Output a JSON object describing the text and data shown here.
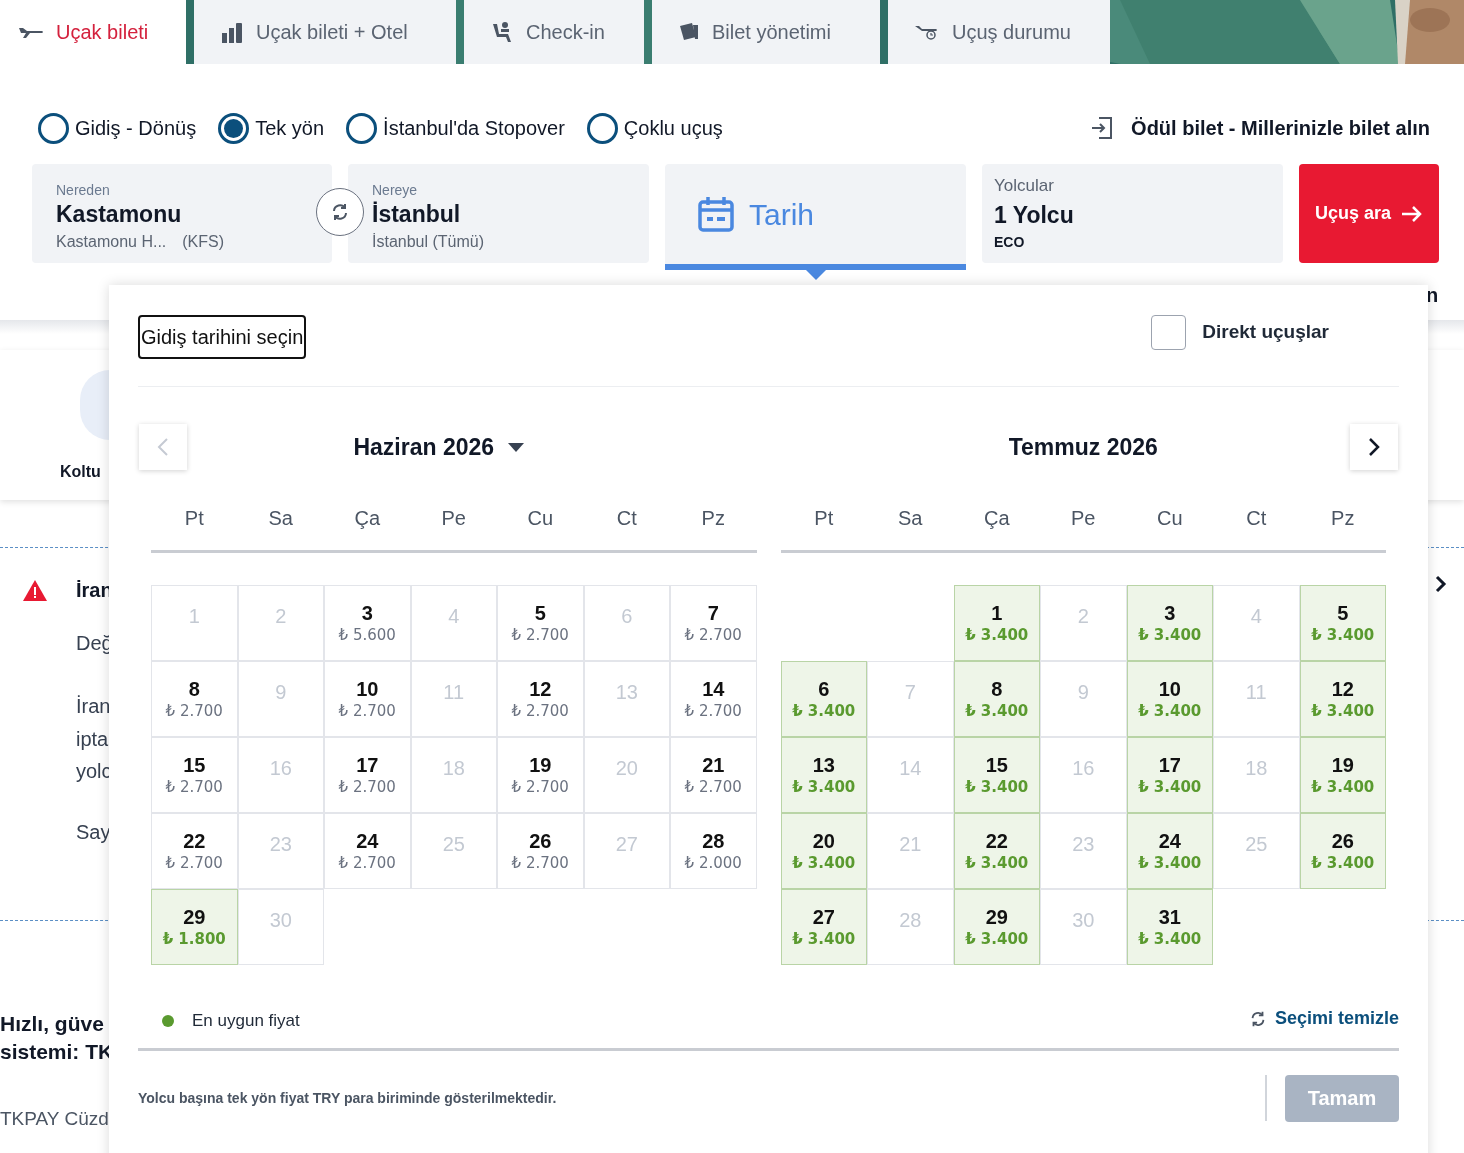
{
  "tabs": [
    {
      "label": "Uçak bileti",
      "kind": "plane",
      "selected": true
    },
    {
      "label": "Uçak bileti + Otel",
      "kind": "hotel",
      "selected": false
    },
    {
      "label": "Check-in",
      "kind": "seat",
      "selected": false
    },
    {
      "label": "Bilet yönetimi",
      "kind": "ticket",
      "selected": false
    },
    {
      "label": "Uçuş durumu",
      "kind": "status",
      "selected": false
    }
  ],
  "trip_types": [
    {
      "label": "Gidiş - Dönüş",
      "selected": false
    },
    {
      "label": "Tek yön",
      "selected": true
    },
    {
      "label": "İstanbul'da Stopover",
      "selected": false
    },
    {
      "label": "Çoklu uçuş",
      "selected": false
    }
  ],
  "award_link": "Ödül bilet - Millerinizle bilet alın",
  "origin": {
    "label": "Nereden",
    "city": "Kastamonu",
    "airport": "Kastamonu H...",
    "code": "(KFS)"
  },
  "destination": {
    "label": "Nereye",
    "city": "İstanbul",
    "airport": "İstanbul (Tümü)"
  },
  "date_field": {
    "label": "Tarih",
    "selected": true
  },
  "passengers": {
    "label": "Yolcular",
    "value": "1 Yolcu",
    "cabin": "ECO"
  },
  "search_button": "Uçuş ara",
  "background_page": {
    "service_label": "Koltu",
    "right_fragment": "n",
    "notice": {
      "title": "İran",
      "lines": [
        "Değ",
        "İran",
        "ipta",
        "yolc",
        "Say"
      ]
    },
    "promo_title": [
      "Hızlı, güve",
      "sistemi: TK"
    ],
    "promo_text": "TKPAY Cüzd"
  },
  "calendar": {
    "heading": "Gidiş tarihini seçin",
    "direct_flights": {
      "label": "Direkt uçuşlar",
      "checked": false
    },
    "months": [
      {
        "title": "Haziran 2026",
        "dropdown": true,
        "weekdays": [
          "Pt",
          "Sa",
          "Ça",
          "Pe",
          "Cu",
          "Ct",
          "Pz"
        ],
        "days": [
          {
            "kind": "unavailable",
            "day": "1"
          },
          {
            "kind": "unavailable",
            "day": "2"
          },
          {
            "kind": "available",
            "day": "3",
            "price": "₺ 5.600"
          },
          {
            "kind": "unavailable",
            "day": "4"
          },
          {
            "kind": "available",
            "day": "5",
            "price": "₺ 2.700"
          },
          {
            "kind": "unavailable",
            "day": "6"
          },
          {
            "kind": "available",
            "day": "7",
            "price": "₺ 2.700"
          },
          {
            "kind": "available",
            "day": "8",
            "price": "₺ 2.700"
          },
          {
            "kind": "unavailable",
            "day": "9"
          },
          {
            "kind": "available",
            "day": "10",
            "price": "₺ 2.700"
          },
          {
            "kind": "unavailable",
            "day": "11"
          },
          {
            "kind": "available",
            "day": "12",
            "price": "₺ 2.700"
          },
          {
            "kind": "unavailable",
            "day": "13"
          },
          {
            "kind": "available",
            "day": "14",
            "price": "₺ 2.700"
          },
          {
            "kind": "available",
            "day": "15",
            "price": "₺ 2.700"
          },
          {
            "kind": "unavailable",
            "day": "16"
          },
          {
            "kind": "available",
            "day": "17",
            "price": "₺ 2.700"
          },
          {
            "kind": "unavailable",
            "day": "18"
          },
          {
            "kind": "available",
            "day": "19",
            "price": "₺ 2.700"
          },
          {
            "kind": "unavailable",
            "day": "20"
          },
          {
            "kind": "available",
            "day": "21",
            "price": "₺ 2.700"
          },
          {
            "kind": "available",
            "day": "22",
            "price": "₺ 2.700"
          },
          {
            "kind": "unavailable",
            "day": "23"
          },
          {
            "kind": "available",
            "day": "24",
            "price": "₺ 2.700"
          },
          {
            "kind": "unavailable",
            "day": "25"
          },
          {
            "kind": "available",
            "day": "26",
            "price": "₺ 2.700"
          },
          {
            "kind": "unavailable",
            "day": "27"
          },
          {
            "kind": "available",
            "day": "28",
            "price": "₺ 2.000"
          },
          {
            "kind": "cheapest",
            "day": "29",
            "price": "₺ 1.800"
          },
          {
            "kind": "unavailable",
            "day": "30"
          }
        ]
      },
      {
        "title": "Temmuz 2026",
        "dropdown": false,
        "weekdays": [
          "Pt",
          "Sa",
          "Ça",
          "Pe",
          "Cu",
          "Ct",
          "Pz"
        ],
        "days": [
          {
            "kind": "blank"
          },
          {
            "kind": "blank"
          },
          {
            "kind": "cheapest",
            "day": "1",
            "price": "₺ 3.400"
          },
          {
            "kind": "unavailable",
            "day": "2"
          },
          {
            "kind": "cheapest",
            "day": "3",
            "price": "₺ 3.400"
          },
          {
            "kind": "unavailable",
            "day": "4"
          },
          {
            "kind": "cheapest",
            "day": "5",
            "price": "₺ 3.400"
          },
          {
            "kind": "cheapest",
            "day": "6",
            "price": "₺ 3.400"
          },
          {
            "kind": "unavailable",
            "day": "7"
          },
          {
            "kind": "cheapest",
            "day": "8",
            "price": "₺ 3.400"
          },
          {
            "kind": "unavailable",
            "day": "9"
          },
          {
            "kind": "cheapest",
            "day": "10",
            "price": "₺ 3.400"
          },
          {
            "kind": "unavailable",
            "day": "11"
          },
          {
            "kind": "cheapest",
            "day": "12",
            "price": "₺ 3.400"
          },
          {
            "kind": "cheapest",
            "day": "13",
            "price": "₺ 3.400"
          },
          {
            "kind": "unavailable",
            "day": "14"
          },
          {
            "kind": "cheapest",
            "day": "15",
            "price": "₺ 3.400"
          },
          {
            "kind": "unavailable",
            "day": "16"
          },
          {
            "kind": "cheapest",
            "day": "17",
            "price": "₺ 3.400"
          },
          {
            "kind": "unavailable",
            "day": "18"
          },
          {
            "kind": "cheapest",
            "day": "19",
            "price": "₺ 3.400"
          },
          {
            "kind": "cheapest",
            "day": "20",
            "price": "₺ 3.400"
          },
          {
            "kind": "unavailable",
            "day": "21"
          },
          {
            "kind": "cheapest",
            "day": "22",
            "price": "₺ 3.400"
          },
          {
            "kind": "unavailable",
            "day": "23"
          },
          {
            "kind": "cheapest",
            "day": "24",
            "price": "₺ 3.400"
          },
          {
            "kind": "unavailable",
            "day": "25"
          },
          {
            "kind": "cheapest",
            "day": "26",
            "price": "₺ 3.400"
          },
          {
            "kind": "cheapest",
            "day": "27",
            "price": "₺ 3.400"
          },
          {
            "kind": "unavailable",
            "day": "28"
          },
          {
            "kind": "cheapest",
            "day": "29",
            "price": "₺ 3.400"
          },
          {
            "kind": "unavailable",
            "day": "30"
          },
          {
            "kind": "cheapest",
            "day": "31",
            "price": "₺ 3.400"
          }
        ]
      }
    ],
    "legend": "En uygun fiyat",
    "clear": "Seçimi temizle",
    "note": "Yolcu başına tek yön fiyat TRY para biriminde gösterilmektedir.",
    "ok_button": {
      "label": "Tamam",
      "disabled": true
    }
  }
}
